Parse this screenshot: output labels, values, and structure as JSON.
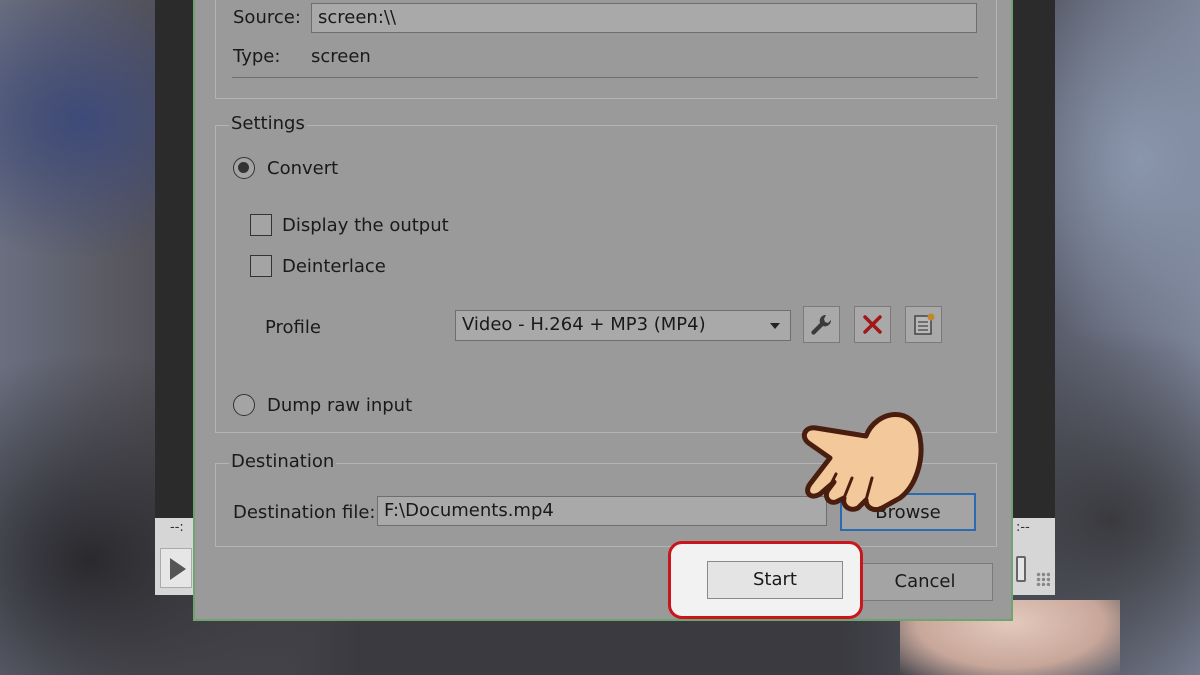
{
  "source_section": {
    "source_label": "Source:",
    "source_value": "screen:\\\\",
    "type_label": "Type:",
    "type_value": "screen"
  },
  "settings": {
    "group_label": "Settings",
    "convert_label": "Convert",
    "convert_selected": true,
    "display_output_label": "Display the output",
    "display_output_checked": false,
    "deinterlace_label": "Deinterlace",
    "deinterlace_checked": false,
    "profile_label": "Profile",
    "profile_value": "Video - H.264 + MP3 (MP4)",
    "profile_icons": [
      "wrench-icon",
      "delete-x-icon",
      "new-profile-icon"
    ],
    "dump_raw_label": "Dump raw input",
    "dump_raw_selected": false
  },
  "destination": {
    "group_label": "Destination",
    "file_label": "Destination file:",
    "file_value": "F:\\Documents.mp4",
    "browse_label": "Browse"
  },
  "buttons": {
    "start_label": "Start",
    "cancel_label": "Cancel"
  },
  "background_player": {
    "time_left": "--:",
    "time_right": ":--"
  },
  "colors": {
    "highlight": "#c9151b",
    "dialog_dim": "#9a9a9a",
    "browse_focus": "#2a6ab0"
  }
}
